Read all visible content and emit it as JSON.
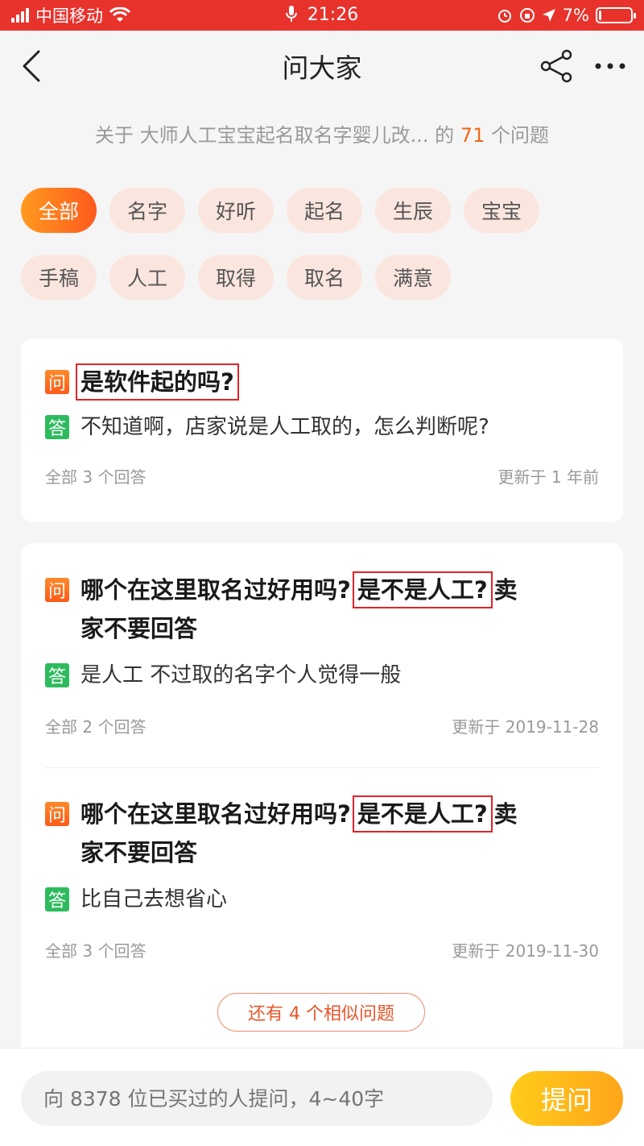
{
  "status_bar": {
    "carrier": "中国移动",
    "time": "21:26",
    "battery": "7%",
    "battery_level": 0.07
  },
  "nav": {
    "title": "问大家"
  },
  "subtitle": {
    "prefix": "关于 大师人工宝宝起名取名字婴儿改...",
    "middle": " 的 ",
    "count": "71",
    "suffix": " 个问题"
  },
  "tags": {
    "row1": [
      "全部",
      "名字",
      "好听",
      "起名",
      "生辰",
      "宝宝"
    ],
    "row2": [
      "手稿",
      "人工",
      "取得",
      "取名",
      "满意"
    ],
    "active": "全部"
  },
  "badges": {
    "question": "问",
    "answer": "答"
  },
  "card1": {
    "question": "是软件起的吗?",
    "answer": "不知道啊，店家说是人工取的，怎么判断呢?",
    "count": "全部 3 个回答",
    "updated": "更新于 1 年前"
  },
  "card2": {
    "items": [
      {
        "q_before": "哪个在这里取名过好用吗?",
        "q_highlight": "是不是人工?",
        "q_after1": "卖",
        "q_after2": "家不要回答",
        "answer": "是人工 不过取的名字个人觉得一般",
        "count": "全部 2 个回答",
        "updated": "更新于 2019-11-28"
      },
      {
        "q_before": "哪个在这里取名过好用吗?",
        "q_highlight": "是不是人工?",
        "q_after1": "卖",
        "q_after2": "家不要回答",
        "answer": "比自己去想省心",
        "count": "全部 3 个回答",
        "updated": "更新于 2019-11-30"
      }
    ],
    "more": "还有 4 个相似问题"
  },
  "bottom": {
    "placeholder": "向 8378 位已买过的人提问，4~40字",
    "ask": "提问"
  }
}
